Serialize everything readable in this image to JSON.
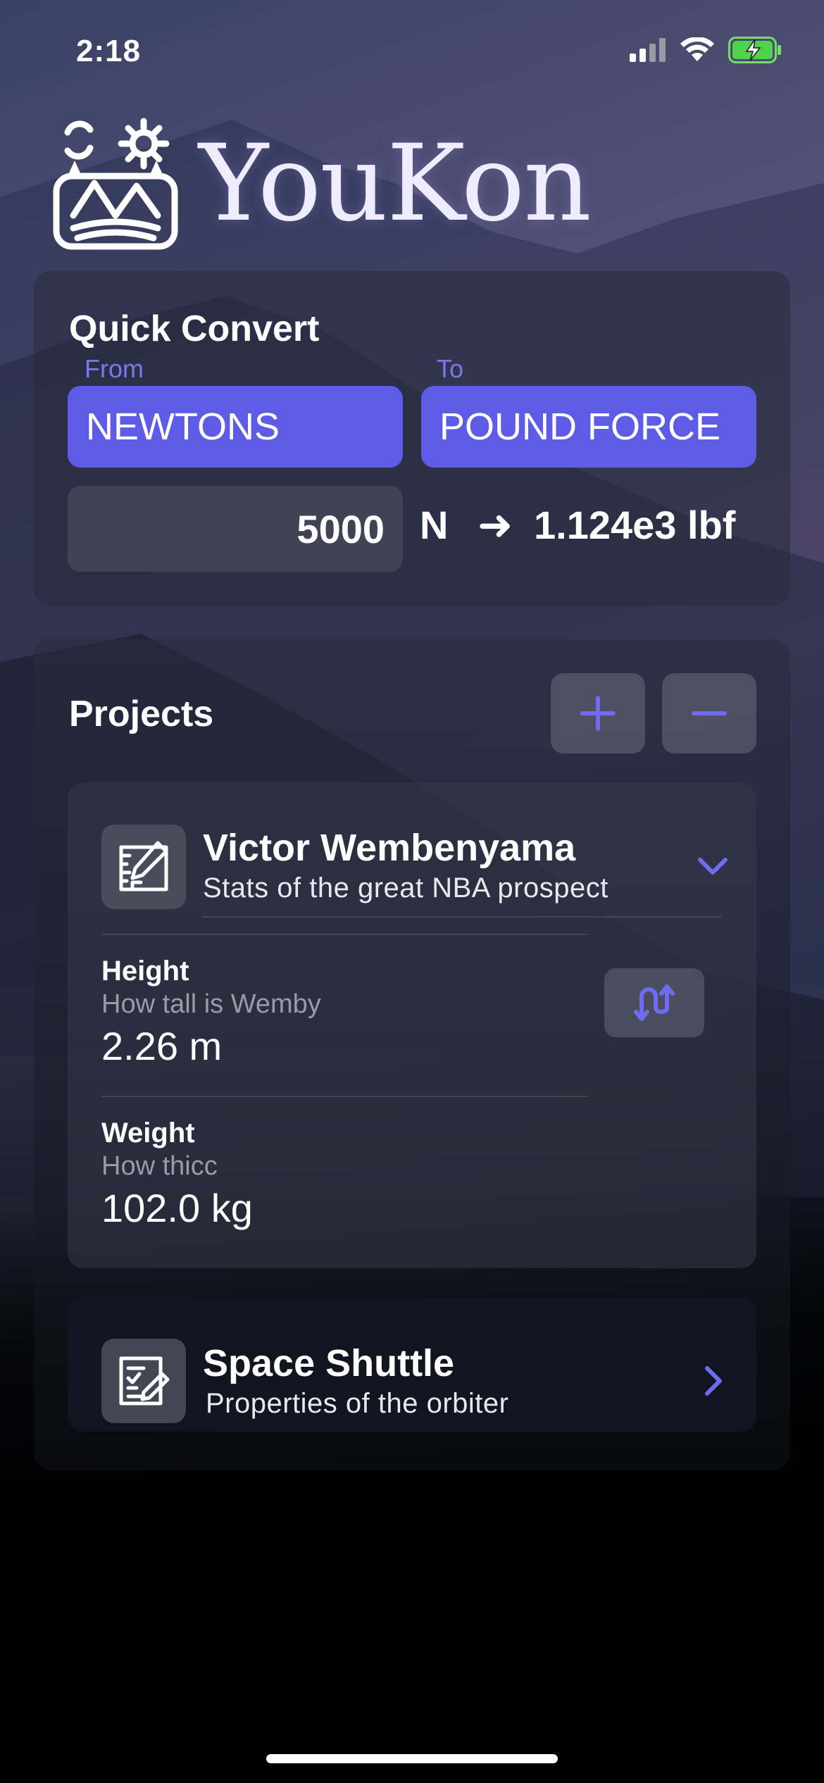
{
  "status_bar": {
    "time": "2:18"
  },
  "app": {
    "title": "YouKon"
  },
  "quick_convert": {
    "title": "Quick Convert",
    "from_label": "From",
    "to_label": "To",
    "from_unit": "NEWTONS",
    "to_unit": "POUND FORCE",
    "input_value": "5000",
    "input_unit": "N",
    "arrow": "➜",
    "result": "1.124e3 lbf"
  },
  "projects": {
    "title": "Projects",
    "items": [
      {
        "title": "Victor Wembenyama",
        "subtitle": "Stats of the great NBA prospect",
        "metrics": [
          {
            "label": "Height",
            "description": "How tall is Wemby",
            "value": "2.26 m"
          },
          {
            "label": "Weight",
            "description": "How thicc",
            "value": "102.0 kg"
          }
        ]
      },
      {
        "title": "Space Shuttle",
        "subtitle": "Properties of the orbiter"
      }
    ]
  },
  "colors": {
    "accent": "#5e5ce6",
    "accent_icon": "#6e6cf0"
  }
}
